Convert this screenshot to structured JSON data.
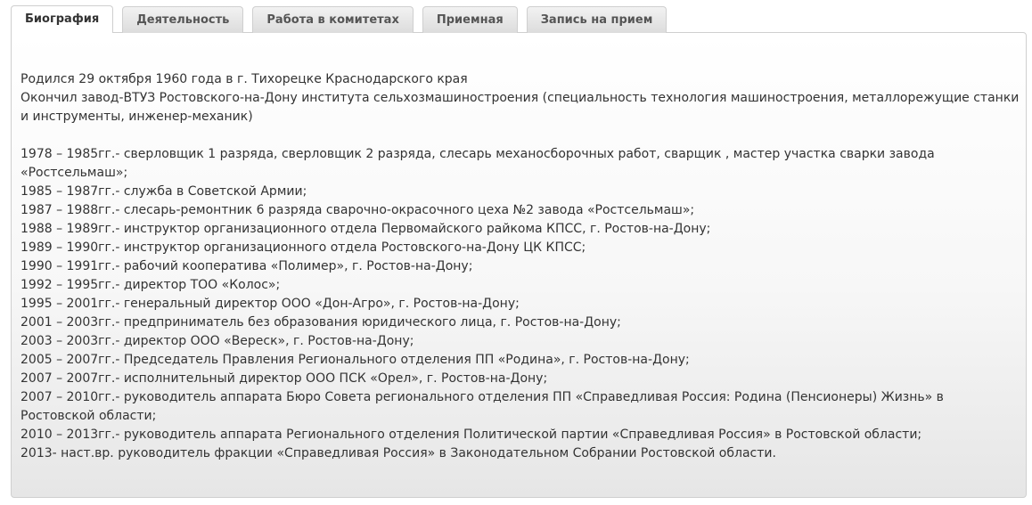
{
  "tabs": [
    {
      "label": "Биография",
      "active": true
    },
    {
      "label": "Деятельность",
      "active": false
    },
    {
      "label": "Работа в комитетах",
      "active": false
    },
    {
      "label": "Приемная",
      "active": false
    },
    {
      "label": "Запись на прием",
      "active": false
    }
  ],
  "bio": {
    "born": "Родился 29 октября 1960 года в г. Тихорецке Краснодарского края",
    "education": "Окончил завод-ВТУЗ Ростовского-на-Дону института сельхозмашиностроения (специальность технология машиностроения, металлорежущие станки и инструменты, инженер-механик)",
    "career": [
      "1978 – 1985гг.- сверловщик 1 разряда, сверловщик 2 разряда, слесарь механосборочных работ, сварщик , мастер участка сварки завода «Ростсельмаш»;",
      "1985 – 1987гг.- служба в Советской Армии;",
      "1987 – 1988гг.- слесарь-ремонтник 6 разряда сварочно-окрасочного цеха №2 завода «Ростсельмаш»;",
      "1988 – 1989гг.- инструктор организационного отдела Первомайского райкома КПСС, г. Ростов-на-Дону;",
      "1989 – 1990гг.- инструктор организационного отдела Ростовского-на-Дону ЦК КПСС;",
      "1990 – 1991гг.- рабочий кооператива «Полимер», г. Ростов-на-Дону;",
      "1992 – 1995гг.- директор ТОО «Колос»;",
      "1995 – 2001гг.- генеральный директор ООО «Дон-Агро», г. Ростов-на-Дону;",
      "2001 – 2003гг.- предприниматель без образования юридического лица, г. Ростов-на-Дону;",
      "2003 – 2003гг.- директор ООО «Вереск», г. Ростов-на-Дону;",
      "2005 – 2007гг.- Председатель Правления Регионального отделения ПП «Родина», г. Ростов-на-Дону;",
      "2007 – 2007гг.- исполнительный директор ООО ПСК «Орел», г. Ростов-на-Дону;",
      "2007 – 2010гг.- руководитель аппарата Бюро Совета регионального отделения ПП «Справедливая Россия: Родина (Пенсионеры) Жизнь» в Ростовской области;",
      "2010 – 2013гг.- руководитель аппарата Регионального отделения Политической партии «Справедливая Россия» в Ростовской области;",
      "2013- наст.вр. руководитель фракции «Справедливая Россия» в Законодательном Собрании Ростовской области."
    ]
  }
}
